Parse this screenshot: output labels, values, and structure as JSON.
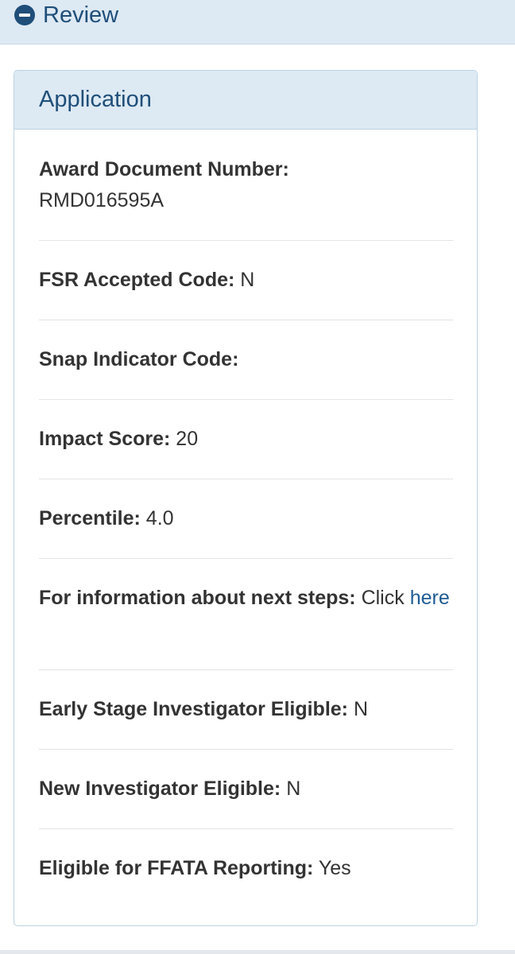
{
  "review": {
    "label": "Review",
    "icon": "minus-circle-icon"
  },
  "panel": {
    "title": "Application",
    "fields": [
      {
        "label": "Award Document Number:",
        "value": "RMD016595A"
      },
      {
        "label": "FSR Accepted Code:",
        "value": "N"
      },
      {
        "label": "Snap Indicator Code:",
        "value": ""
      },
      {
        "label": "Impact Score:",
        "value": "20"
      },
      {
        "label": "Percentile:",
        "value": "4.0"
      },
      {
        "label": "For information about next steps:",
        "value": "Click",
        "link_text": "here"
      },
      {
        "label": "Early Stage Investigator Eligible:",
        "value": "N"
      },
      {
        "label": "New Investigator Eligible:",
        "value": "N"
      },
      {
        "label": "Eligible for FFATA Reporting:",
        "value": "Yes"
      }
    ]
  },
  "colors": {
    "header_bg": "#dde9f3",
    "accent": "#1f4e79",
    "link": "#1f5b94",
    "text": "#333333"
  }
}
